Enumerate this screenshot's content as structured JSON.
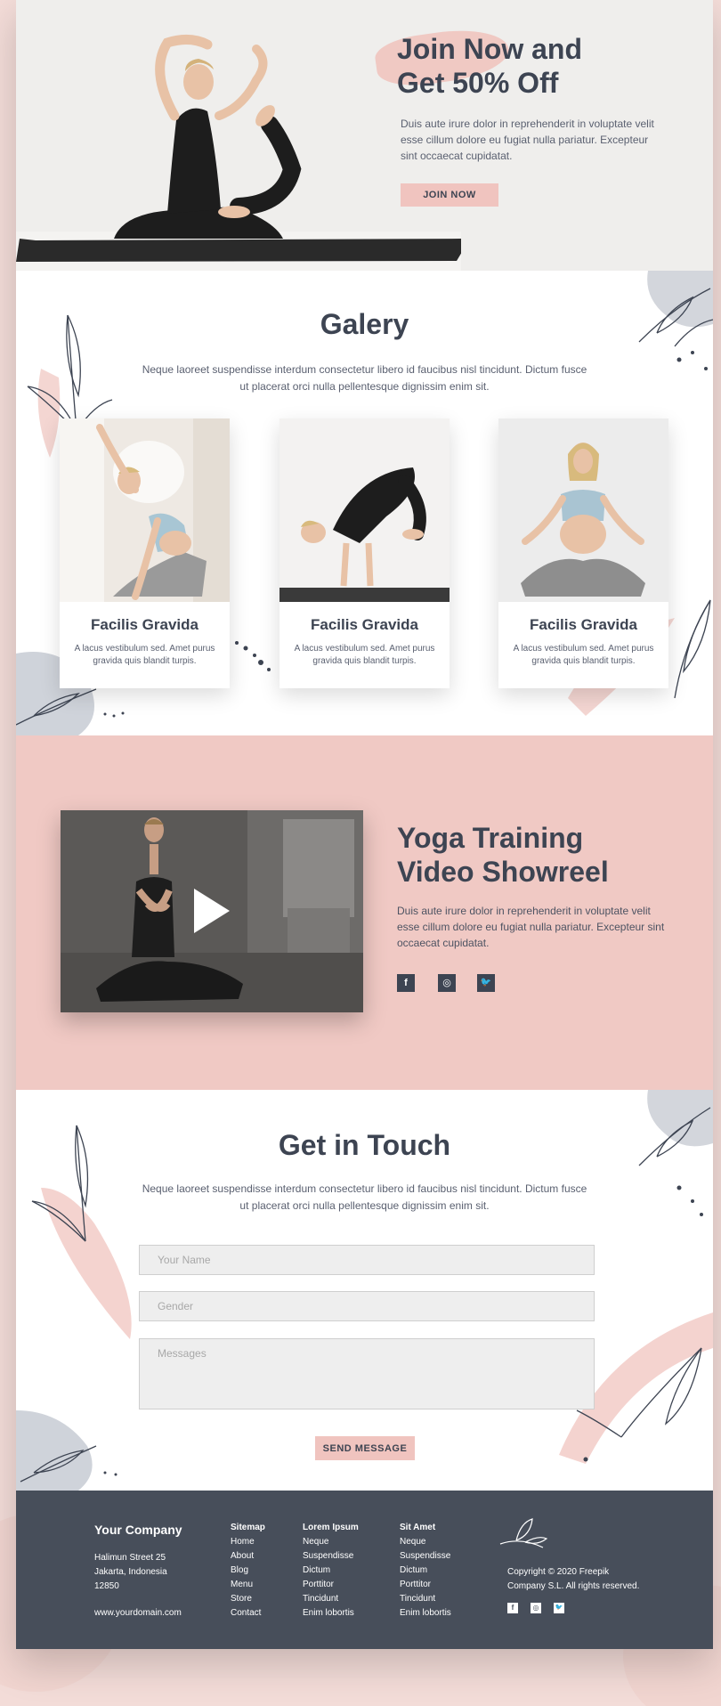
{
  "hero": {
    "title_line1": "Join Now and",
    "title_line2": "Get 50% Off",
    "text": "Duis aute irure dolor in reprehenderit in voluptate velit esse cillum dolore eu fugiat nulla pariatur. Excepteur sint occaecat cupidatat.",
    "button": "JOIN NOW"
  },
  "gallery": {
    "title": "Galery",
    "desc": "Neque laoreet suspendisse interdum consectetur libero id faucibus nisl tincidunt. Dictum fusce ut placerat orci nulla pellentesque dignissim enim sit.",
    "cards": [
      {
        "title": "Facilis Gravida",
        "text": "A lacus vestibulum sed. Amet purus gravida quis blandit turpis."
      },
      {
        "title": "Facilis Gravida",
        "text": "A lacus vestibulum sed. Amet purus gravida quis blandit turpis."
      },
      {
        "title": "Facilis Gravida",
        "text": "A lacus vestibulum sed. Amet purus gravida quis blandit turpis."
      }
    ]
  },
  "video": {
    "title_line1": "Yoga Training",
    "title_line2": "Video Showreel",
    "text": "Duis aute irure dolor in reprehenderit in voluptate velit esse cillum dolore eu fugiat nulla pariatur. Excepteur sint occaecat cupidatat.",
    "social": [
      "facebook-icon",
      "instagram-icon",
      "twitter-icon"
    ]
  },
  "contact": {
    "title": "Get in Touch",
    "desc": "Neque laoreet suspendisse interdum consectetur libero id faucibus nisl tincidunt. Dictum fusce ut placerat orci nulla pellentesque dignissim enim sit.",
    "name_placeholder": "Your Name",
    "gender_placeholder": "Gender",
    "messages_placeholder": "Messages",
    "button": "SEND MESSAGE"
  },
  "footer": {
    "company": "Your Company",
    "address1": "Halimun Street 25",
    "address2": "Jakarta, Indonesia",
    "address3": "12850",
    "domain": "www.yourdomain.com",
    "columns": [
      {
        "heading": "Sitemap",
        "links": [
          "Home",
          "About",
          "Blog",
          "Menu",
          "Store",
          "Contact"
        ]
      },
      {
        "heading": "Lorem Ipsum",
        "links": [
          "Neque",
          "Suspendisse",
          "Dictum",
          "Porttitor",
          "Tincidunt",
          "Enim lobortis"
        ]
      },
      {
        "heading": "Sit Amet",
        "links": [
          "Neque",
          "Suspendisse",
          "Dictum",
          "Porttitor",
          "Tincidunt",
          "Enim lobortis"
        ]
      }
    ],
    "copyright1": "Copyright ©  2020 Freepik",
    "copyright2": "Company S.L. All rights reserved."
  },
  "colors": {
    "accent_pink": "#f0c4bf",
    "dark_slate": "#3d4452",
    "footer_bg": "#474e5a"
  }
}
